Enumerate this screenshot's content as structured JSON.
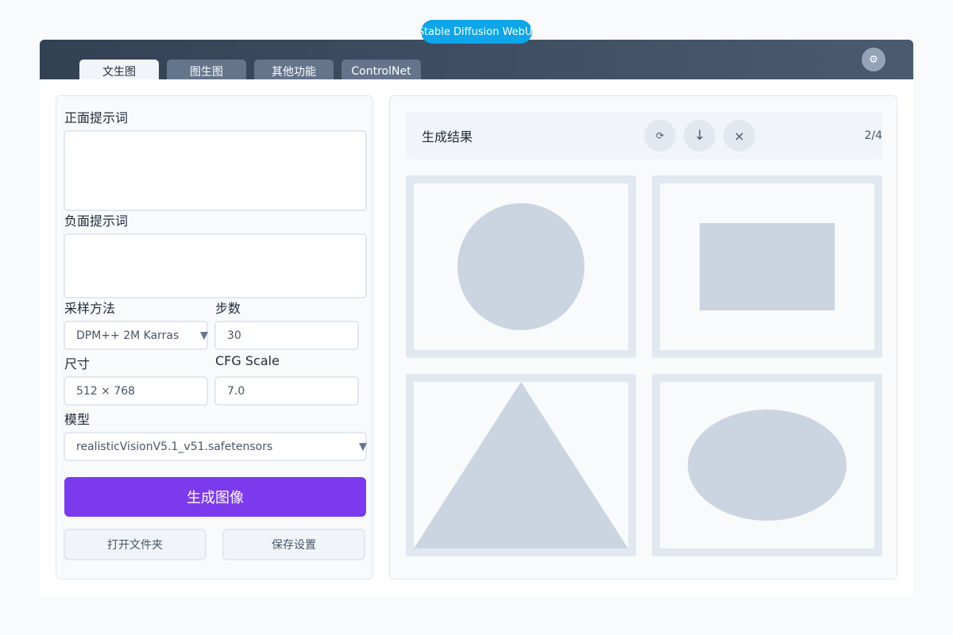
{
  "app": {
    "title": "Stable Diffusion WebUI"
  },
  "tabs": [
    {
      "label": "文生图",
      "active": true
    },
    {
      "label": "图生图",
      "active": false
    },
    {
      "label": "其他功能",
      "active": false
    },
    {
      "label": "ControlNet",
      "active": false
    }
  ],
  "header": {
    "settings_icon": "gear-icon"
  },
  "form": {
    "positive_prompt_label": "正面提示词",
    "positive_prompt_value": "",
    "negative_prompt_label": "负面提示词",
    "negative_prompt_value": "",
    "sampler_label": "采样方法",
    "sampler_value": "DPM++ 2M Karras",
    "steps_label": "步数",
    "steps_value": "30",
    "size_label": "尺寸",
    "size_value": "512 × 768",
    "cfg_label": "CFG Scale",
    "cfg_value": "7.0",
    "model_label": "模型",
    "model_value": "realisticVisionV5.1_v51.safetensors",
    "dropdown_arrow": "▼",
    "generate_label": "生成图像",
    "open_folder_label": "打开文件夹",
    "save_settings_label": "保存设置"
  },
  "results": {
    "title": "生成结果",
    "refresh_glyph": "⟳",
    "download_glyph": "↓",
    "close_glyph": "×",
    "counter": "2/4",
    "images": [
      {
        "shape": "circle"
      },
      {
        "shape": "rectangle"
      },
      {
        "shape": "triangle"
      },
      {
        "shape": "ellipse"
      }
    ]
  },
  "colors": {
    "accent": "#7c3aed",
    "pill": "#0ea5e9",
    "header": "#334155",
    "placeholder": "#cbd5e1"
  }
}
